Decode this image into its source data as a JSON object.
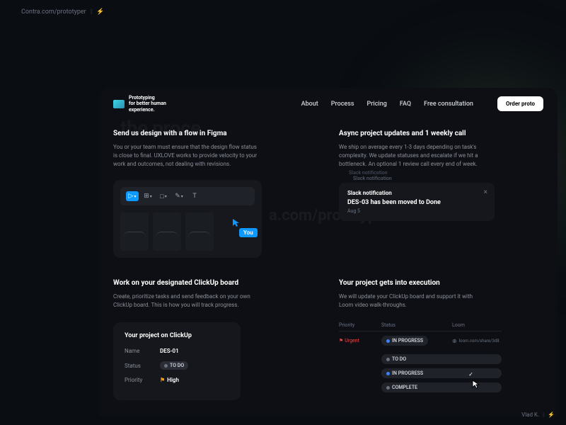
{
  "browser": {
    "url": "Contra.com/prototyper",
    "icon": "⚡"
  },
  "logo": {
    "line1": "Prototyping",
    "line2": "for better human",
    "line3": "experience."
  },
  "nav": {
    "about": "About",
    "process": "Process",
    "pricing": "Pricing",
    "faq": "FAQ",
    "consult": "Free consultation",
    "cta": "Order proto"
  },
  "bg_text": "the proce",
  "watermark": "a.com/prototyper",
  "s1": {
    "title": "Send us design with a flow in Figma",
    "body": "You or your team must ensure that the design flow status is close to final. UXLOVE works to provide velocity to your work and outcomes, not dealing with revisions."
  },
  "s2": {
    "title": "Async project updates and 1 weekly call",
    "body": "We ship on average every 1-3 days depending on task's complexity. We update statuses and escalate if we hit a bottleneck. An optional 1 review call every end of week."
  },
  "s3": {
    "title": "Work on your designated ClickUp board",
    "body": "Create, prioritize tasks and send feedback on your own ClickUp board. This is how you will track progress."
  },
  "s4": {
    "title": "Your project gets into execution",
    "body": "We will update your ClickUp board and support it with Loom video walk-throughs."
  },
  "cursor_label": "You",
  "slack": {
    "ghost1": "Slack notification",
    "ghost2": "Slack notification",
    "title": "Slack notification",
    "msg": "DES-03 has been moved to Done",
    "date": "Aug 5"
  },
  "clickup": {
    "heading": "Your project on ClickUp",
    "name_label": "Name",
    "name": "DES-01",
    "status_label": "Status",
    "status": "TO DO",
    "priority_label": "Priority",
    "priority": "High"
  },
  "table": {
    "h1": "Priority",
    "h2": "Status",
    "h3": "Loom",
    "urgent": "Urgent",
    "inprogress": "IN PROGRESS",
    "loom_url": "loom.com/share/3d8",
    "todo": "TO DO",
    "complete": "COMPLETE"
  },
  "credit": {
    "name": "Vlad K.",
    "icon": "⚡"
  }
}
